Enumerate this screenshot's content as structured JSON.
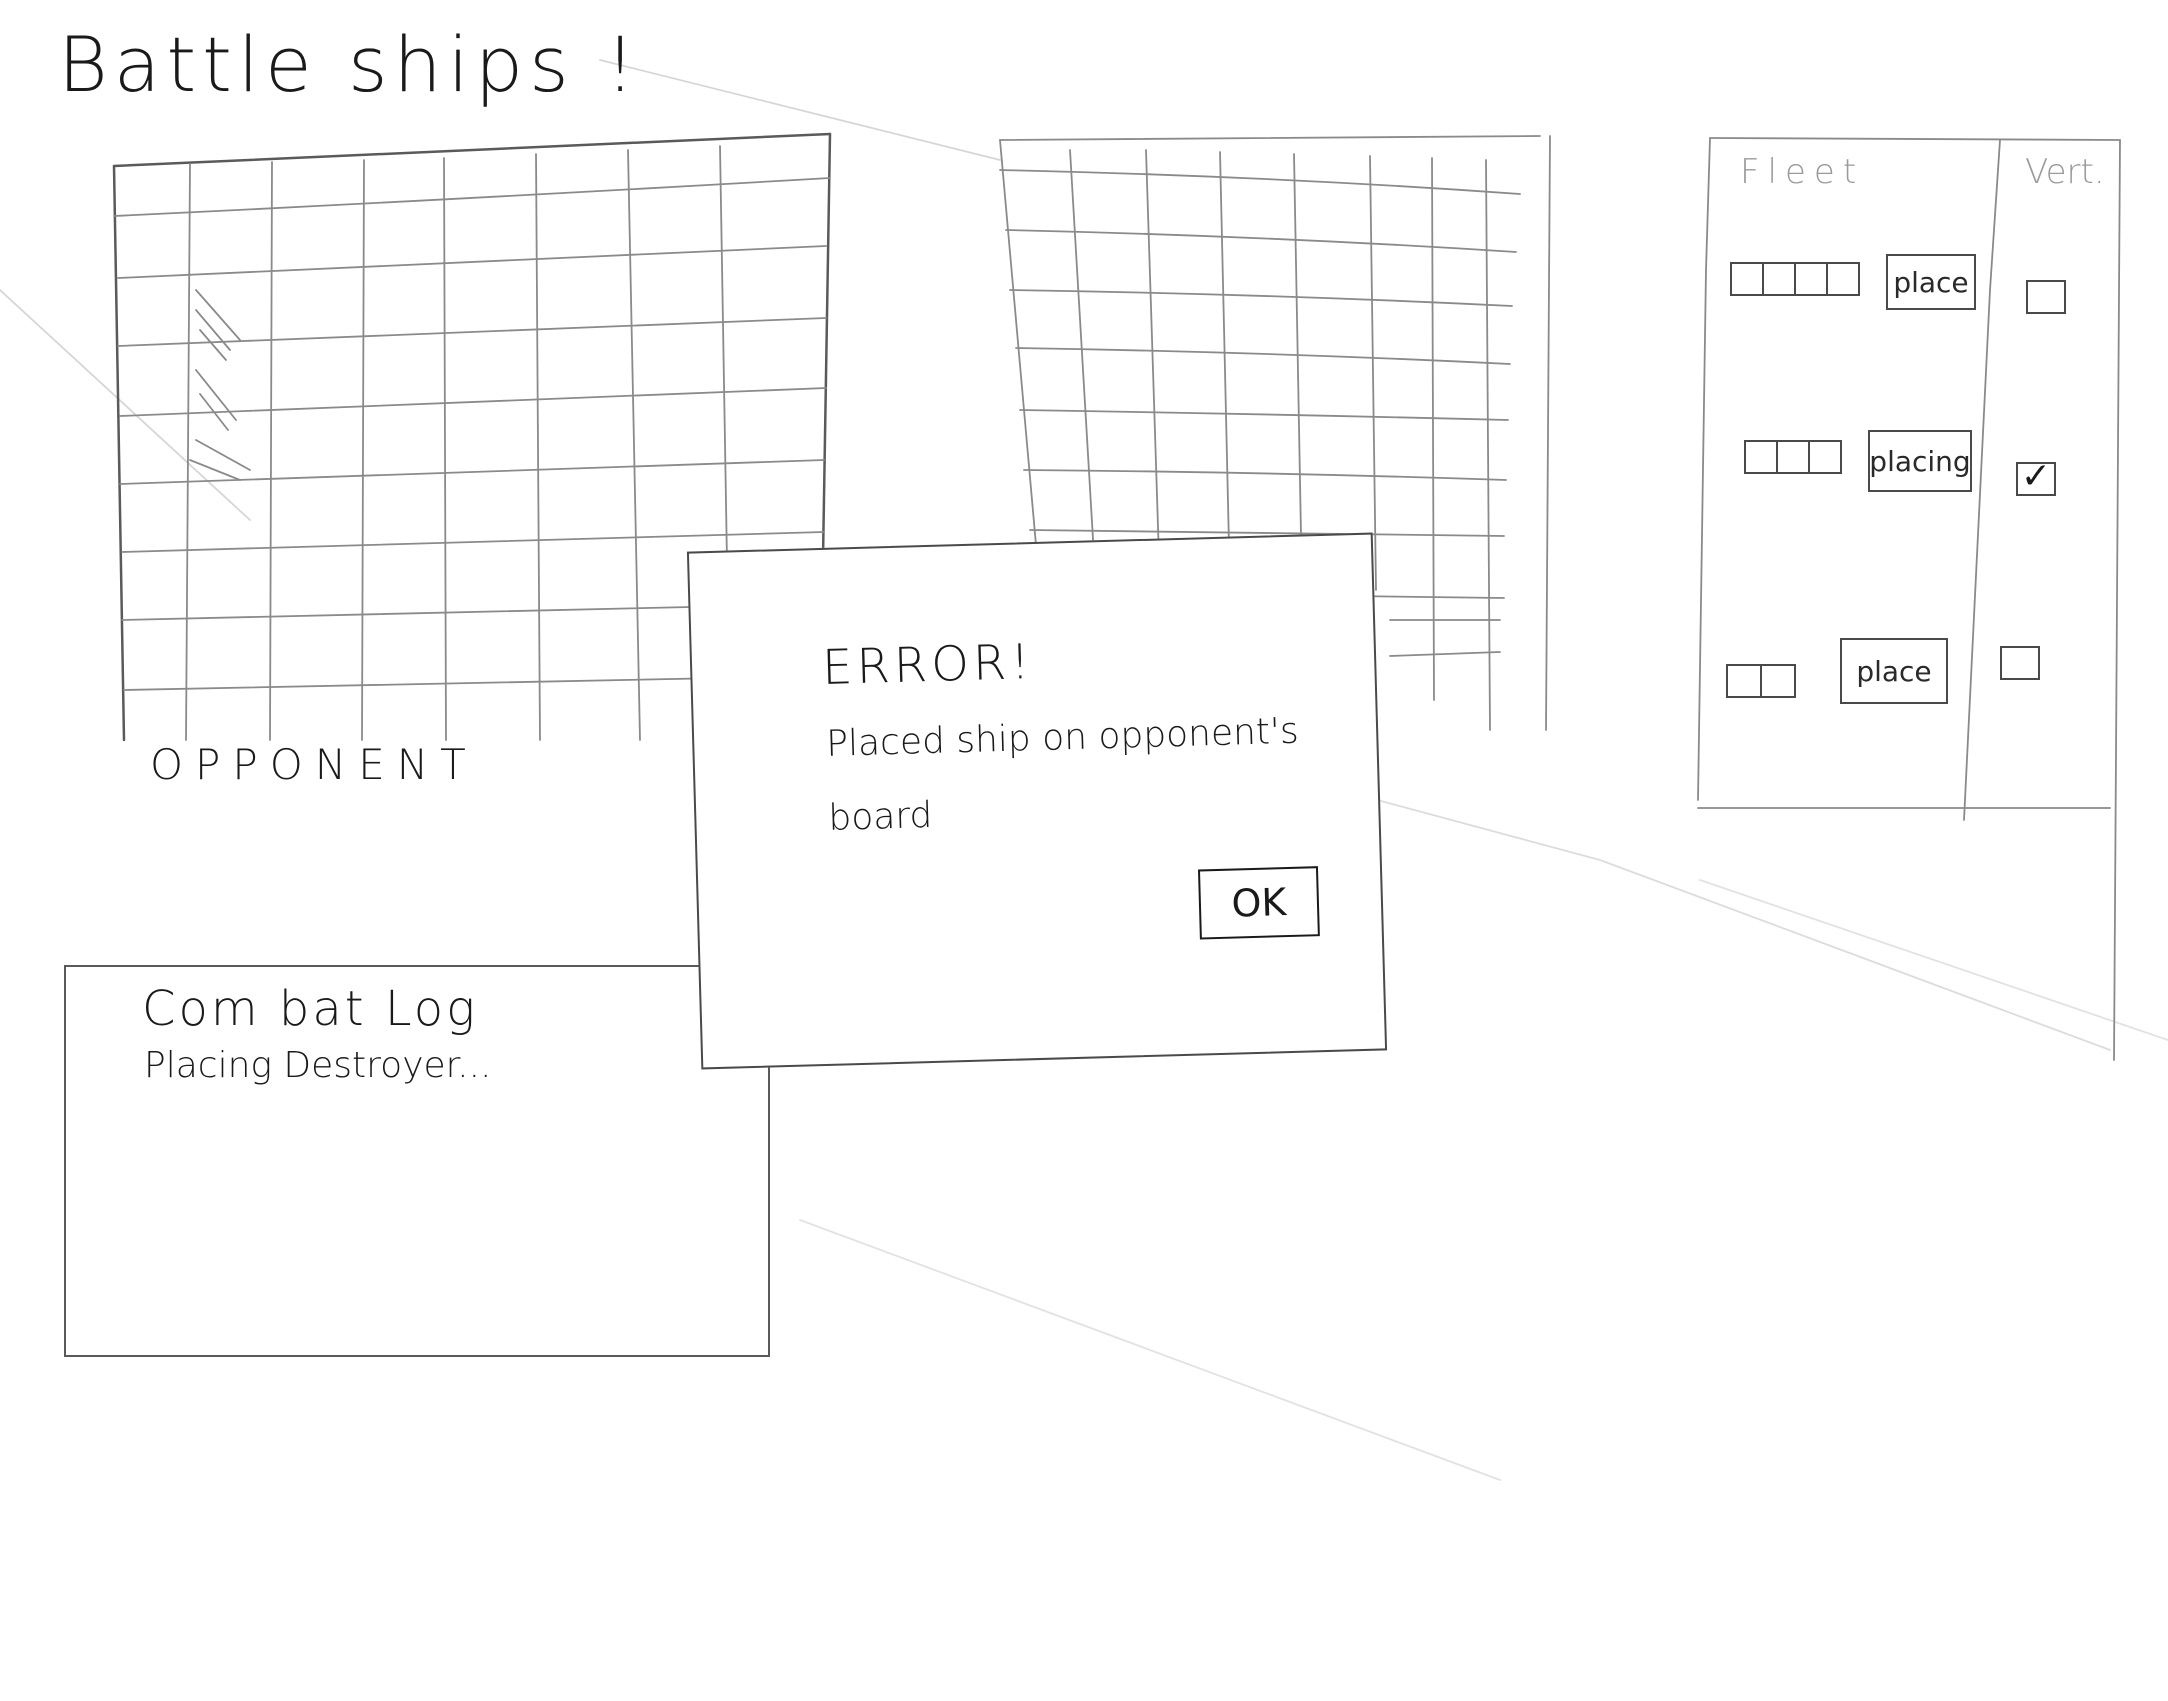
{
  "app": {
    "title": "Battle ships !"
  },
  "opponent_board": {
    "label": "OPPONENT"
  },
  "fleet_panel": {
    "header": "Fleet",
    "vertical_header": "Vert.",
    "ships": [
      {
        "size": 4,
        "button_label": "place",
        "vertical": false
      },
      {
        "size": 3,
        "button_label": "placing",
        "vertical": true
      },
      {
        "size": 2,
        "button_label": "place",
        "vertical": false
      }
    ]
  },
  "error_dialog": {
    "title": "ERROR!",
    "message": "Placed ship on opponent's board",
    "ok_label": "OK"
  },
  "combat_log": {
    "title": "Com bat Log",
    "lines": [
      "Placing Destroyer..."
    ]
  }
}
